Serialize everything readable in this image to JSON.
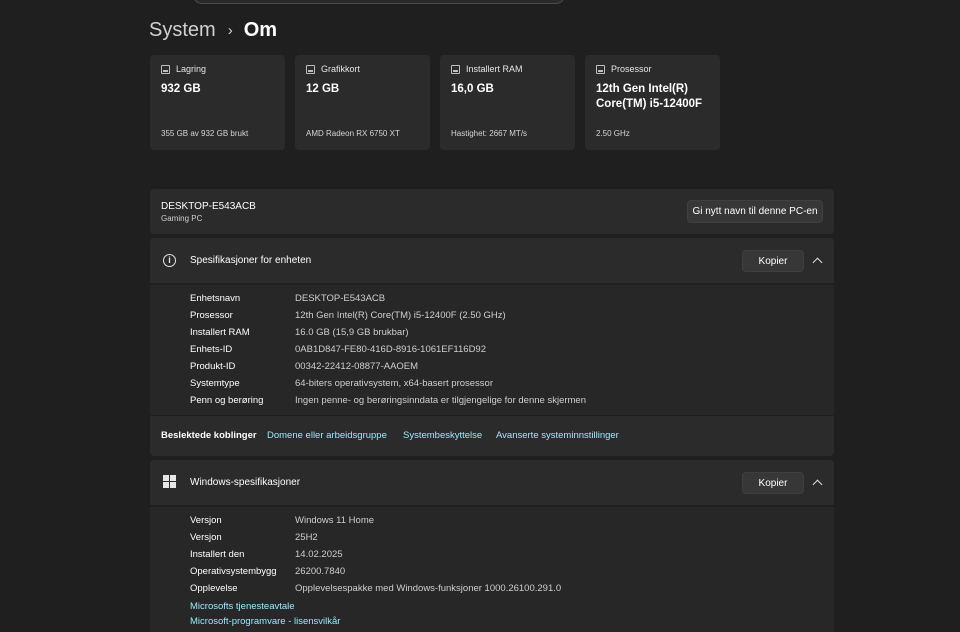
{
  "breadcrumb": {
    "parent": "System",
    "separator": "›",
    "current": "Om"
  },
  "cards": [
    {
      "icon": "storage-icon",
      "label": "Lagring",
      "value": "932 GB",
      "sub": "355 GB av 932 GB brukt"
    },
    {
      "icon": "graphics-card-icon",
      "label": "Grafikkort",
      "value": "12 GB",
      "sub": "AMD Radeon RX 6750 XT"
    },
    {
      "icon": "ram-icon",
      "label": "Installert RAM",
      "value": "16,0 GB",
      "sub": "Hastighet: 2667 MT/s"
    },
    {
      "icon": "processor-icon",
      "label": "Prosessor",
      "value": "12th Gen Intel(R) Core(TM) i5-12400F",
      "sub": "2.50 GHz"
    }
  ],
  "pc": {
    "name": "DESKTOP-E543ACB",
    "type": "Gaming PC",
    "rename_label": "Gi nytt navn til denne PC-en"
  },
  "device_specs": {
    "title": "Spesifikasjoner for enheten",
    "copy_label": "Kopier",
    "rows": [
      {
        "label": "Enhetsnavn",
        "value": "DESKTOP-E543ACB"
      },
      {
        "label": "Prosessor",
        "value": "12th Gen Intel(R) Core(TM) i5-12400F (2.50 GHz)"
      },
      {
        "label": "Installert RAM",
        "value": "16.0 GB (15,9 GB brukbar)"
      },
      {
        "label": "Enhets-ID",
        "value": "0AB1D847-FE80-416D-8916-1061EF116D92"
      },
      {
        "label": "Produkt-ID",
        "value": "00342-22412-08877-AAOEM"
      },
      {
        "label": "Systemtype",
        "value": "64-biters operativsystem, x64-basert prosessor"
      },
      {
        "label": "Penn og berøring",
        "value": "Ingen penne- og berøringsinndata er tilgjengelige for denne skjermen"
      }
    ]
  },
  "related": {
    "label": "Beslektede koblinger",
    "links": [
      "Domene eller arbeidsgruppe",
      "Systembeskyttelse",
      "Avanserte systeminnstillinger"
    ]
  },
  "windows_specs": {
    "title": "Windows-spesifikasjoner",
    "copy_label": "Kopier",
    "rows": [
      {
        "label": "Versjon",
        "value": "Windows 11 Home"
      },
      {
        "label": "Versjon",
        "value": "25H2"
      },
      {
        "label": "Installert den",
        "value": "14.02.2025"
      },
      {
        "label": "Operativsystembygg",
        "value": "26200.7840"
      },
      {
        "label": "Opplevelse",
        "value": "Opplevelsespakke med Windows-funksjoner 1000.26100.291.0"
      }
    ],
    "links": [
      "Microsofts tjenesteavtale",
      "Microsoft-programvare - lisensvilkår"
    ]
  }
}
